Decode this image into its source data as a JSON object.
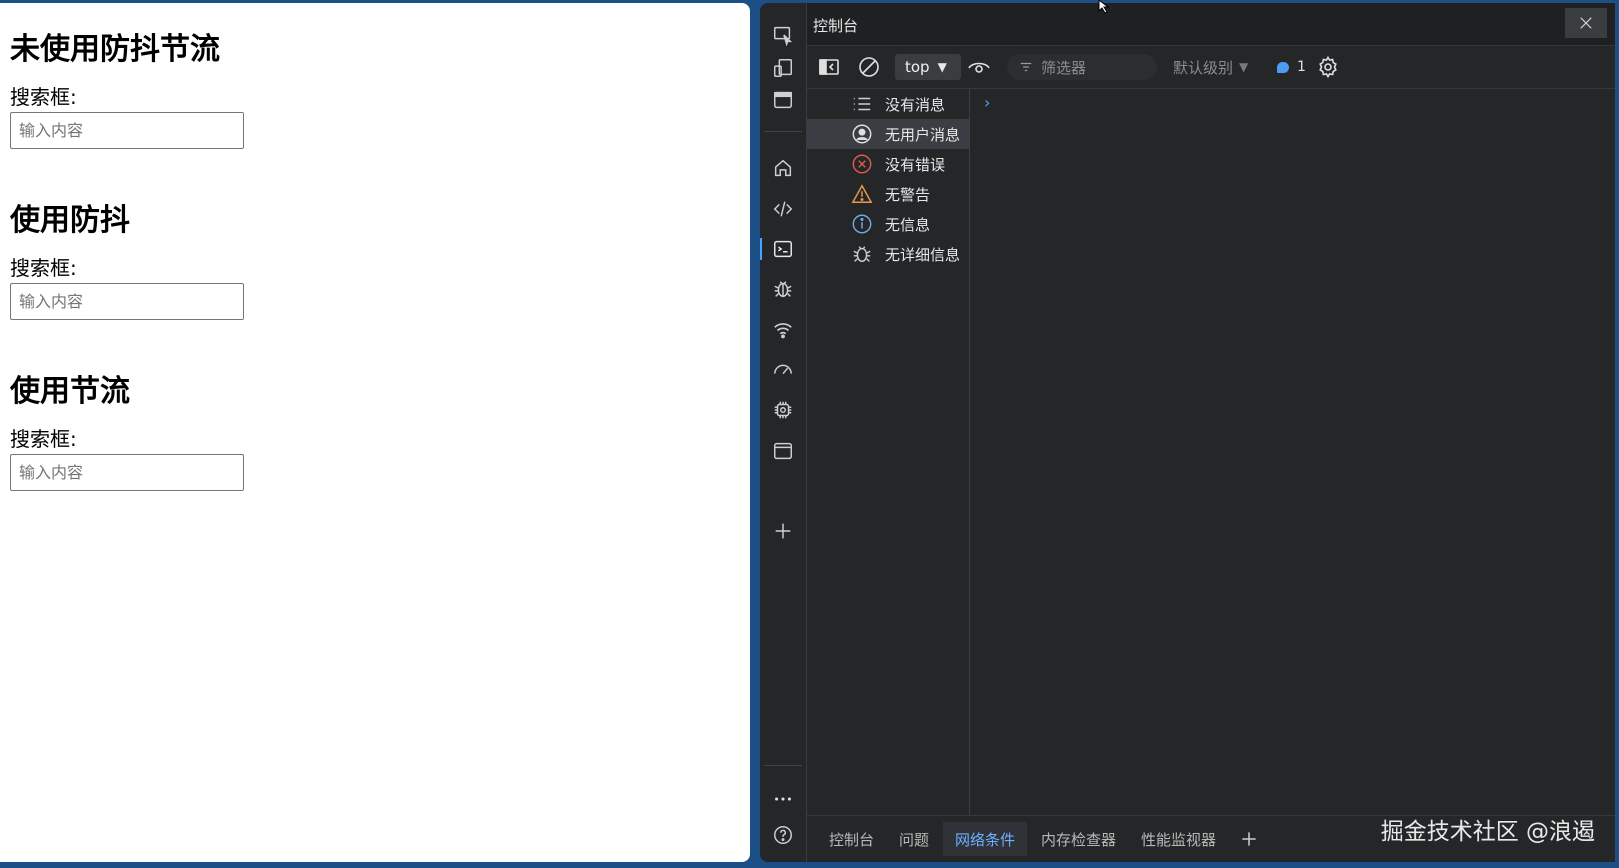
{
  "page": {
    "sections": [
      {
        "heading": "未使用防抖节流",
        "label": "搜索框:",
        "placeholder": "输入内容"
      },
      {
        "heading": "使用防抖",
        "label": "搜索框:",
        "placeholder": "输入内容"
      },
      {
        "heading": "使用节流",
        "label": "搜索框:",
        "placeholder": "输入内容"
      }
    ]
  },
  "devtools": {
    "title": "控制台",
    "toolbar": {
      "context": "top",
      "filter_placeholder": "筛选器",
      "level": "默认级别",
      "message_count": "1"
    },
    "sidebar": [
      {
        "label": "没有消息",
        "icon": "list-icon"
      },
      {
        "label": "无用户消息",
        "icon": "user-icon",
        "selected": true
      },
      {
        "label": "没有错误",
        "icon": "error-icon"
      },
      {
        "label": "无警告",
        "icon": "warning-icon"
      },
      {
        "label": "无信息",
        "icon": "info-icon"
      },
      {
        "label": "无详细信息",
        "icon": "bug-icon"
      }
    ],
    "prompt": "›",
    "drawer_tabs": [
      "控制台",
      "问题",
      "网络条件",
      "内存检查器",
      "性能监视器"
    ],
    "active_drawer_tab": "网络条件",
    "watermark": "掘金技术社区 @浪遏"
  },
  "colors": {
    "accent": "#4aa3ff",
    "error": "#e0584f",
    "warning": "#e69a4a",
    "info": "#6fa8e8"
  }
}
